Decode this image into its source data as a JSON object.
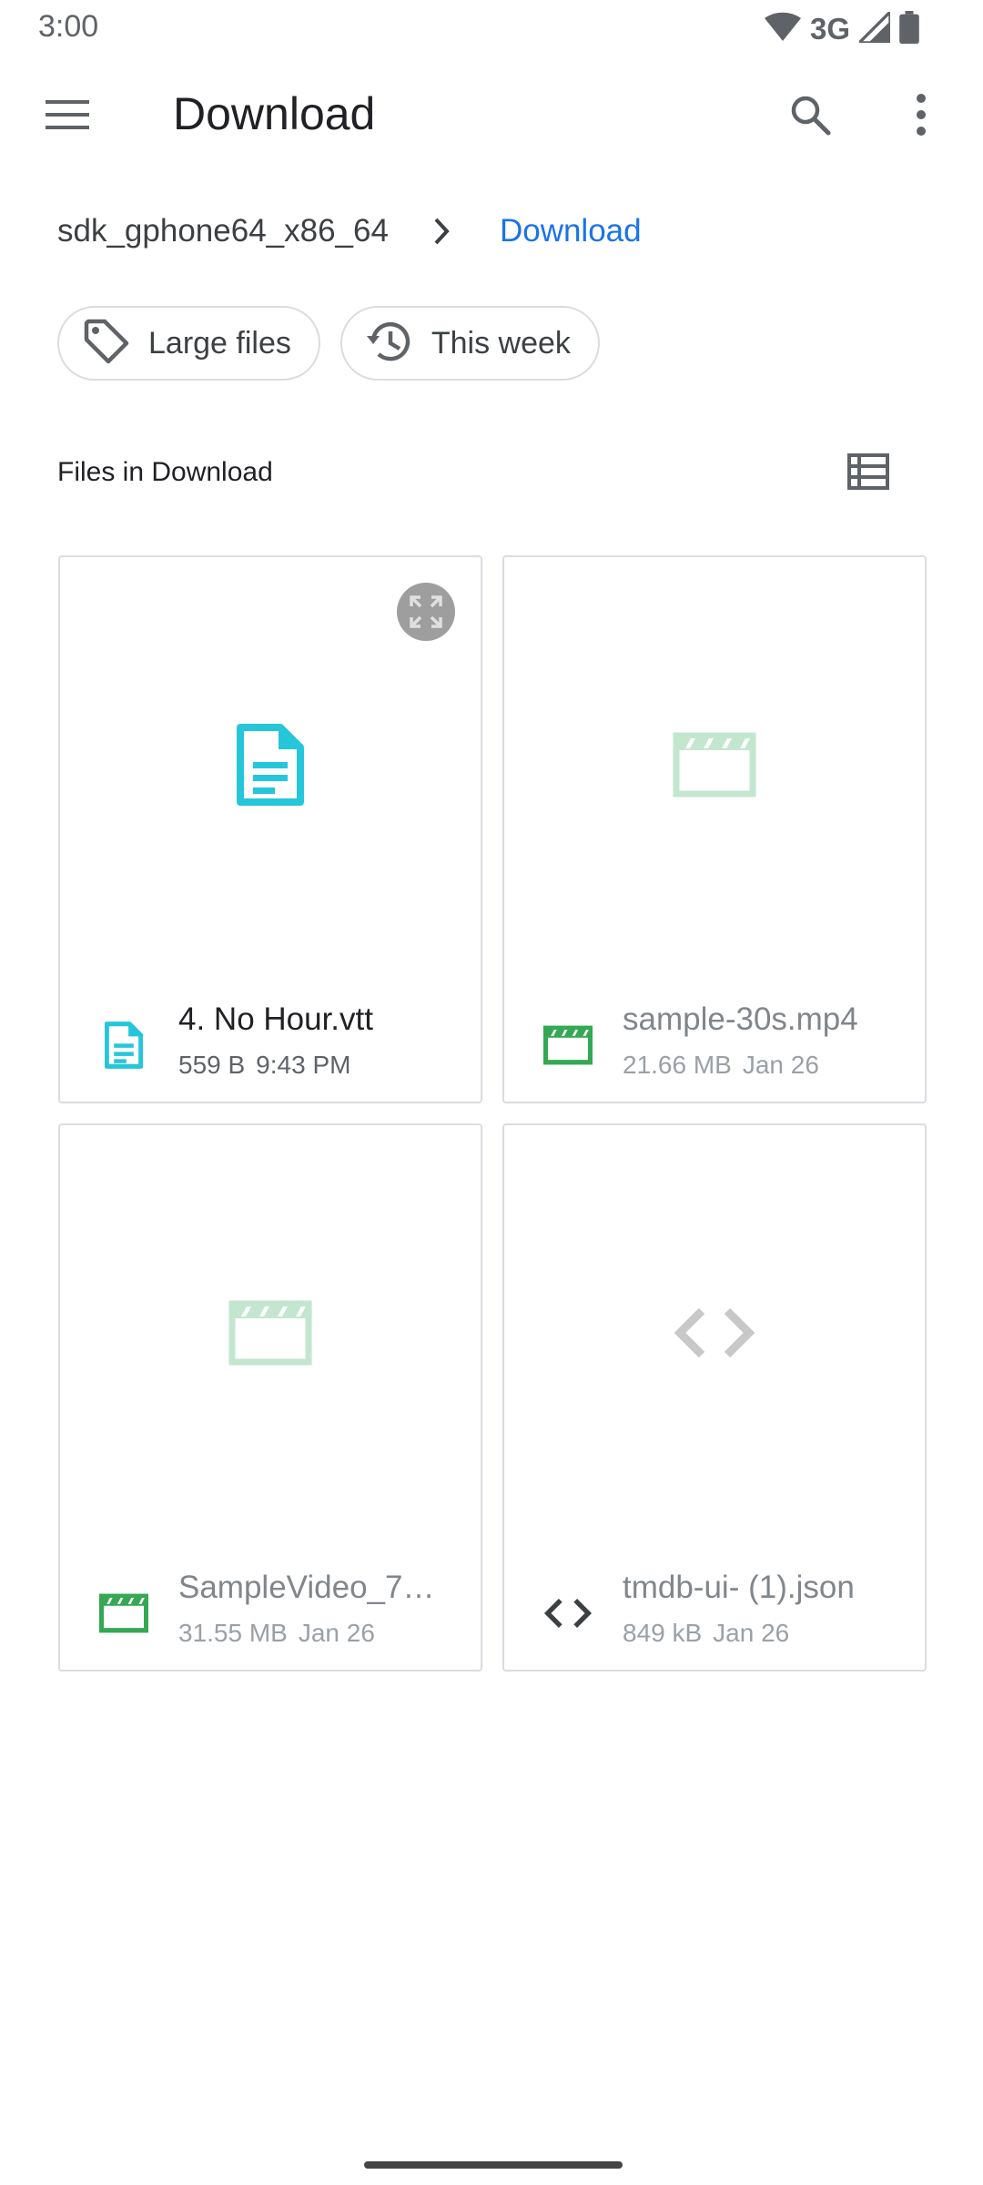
{
  "status_bar": {
    "time": "3:00",
    "network": "3G"
  },
  "toolbar": {
    "title": "Download"
  },
  "breadcrumb": {
    "root": "sdk_gphone64_x86_64",
    "current": "Download"
  },
  "chips": [
    {
      "label": "Large files",
      "icon": "tag-icon"
    },
    {
      "label": "This week",
      "icon": "history-icon"
    }
  ],
  "section": {
    "title": "Files in Download"
  },
  "files": [
    {
      "name": "4. No Hour.vtt",
      "size": "559 B",
      "date": "9:43 PM",
      "type": "document"
    },
    {
      "name": "sample-30s.mp4",
      "size": "21.66 MB",
      "date": "Jan 26",
      "type": "video"
    },
    {
      "name": "SampleVideo_7…",
      "size": "31.55 MB",
      "date": "Jan 26",
      "type": "video"
    },
    {
      "name": "tmdb-ui- (1).json",
      "size": "849 kB",
      "date": "Jan 26",
      "type": "code"
    }
  ],
  "colors": {
    "accent": "#1a73e8",
    "doc_icon": "#26c6da",
    "video_icon": "#34a853",
    "video_thumb": "#c3e6cf",
    "code_thumb": "#c8c8c8",
    "code_icon": "#3c4043"
  }
}
